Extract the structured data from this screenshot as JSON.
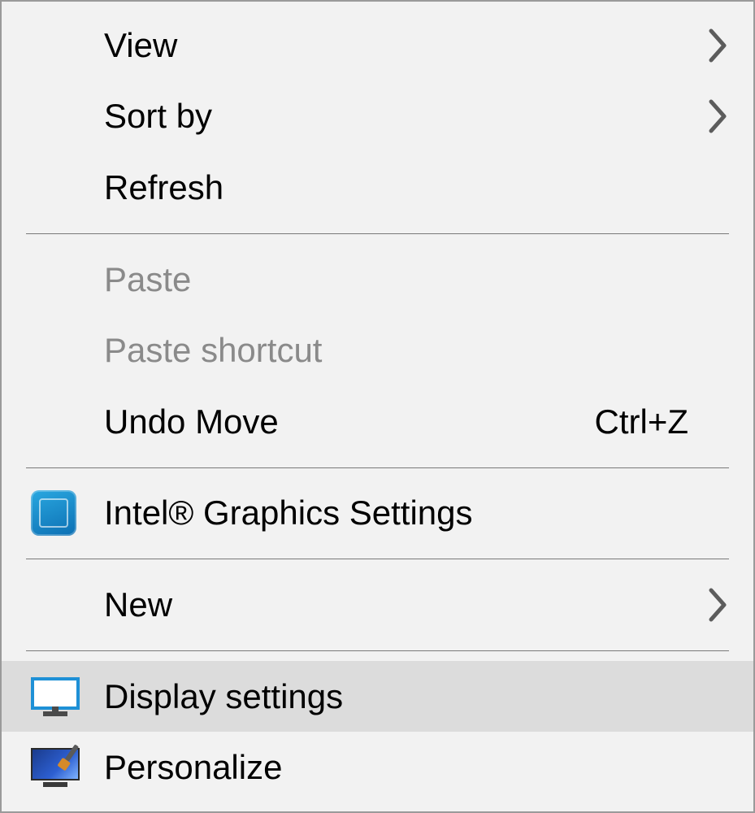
{
  "menu": {
    "items": [
      {
        "label": "View",
        "hasSubmenu": true,
        "disabled": false,
        "icon": null
      },
      {
        "label": "Sort by",
        "hasSubmenu": true,
        "disabled": false,
        "icon": null
      },
      {
        "label": "Refresh",
        "hasSubmenu": false,
        "disabled": false,
        "icon": null
      },
      {
        "separator": true
      },
      {
        "label": "Paste",
        "hasSubmenu": false,
        "disabled": true,
        "icon": null
      },
      {
        "label": "Paste shortcut",
        "hasSubmenu": false,
        "disabled": true,
        "icon": null
      },
      {
        "label": "Undo Move",
        "hasSubmenu": false,
        "disabled": false,
        "icon": null,
        "shortcut": "Ctrl+Z"
      },
      {
        "separator": true
      },
      {
        "label": "Intel® Graphics Settings",
        "hasSubmenu": false,
        "disabled": false,
        "icon": "intel"
      },
      {
        "separator": true
      },
      {
        "label": "New",
        "hasSubmenu": true,
        "disabled": false,
        "icon": null
      },
      {
        "separator": true
      },
      {
        "label": "Display settings",
        "hasSubmenu": false,
        "disabled": false,
        "icon": "display",
        "hovered": true
      },
      {
        "label": "Personalize",
        "hasSubmenu": false,
        "disabled": false,
        "icon": "personalize"
      }
    ]
  }
}
